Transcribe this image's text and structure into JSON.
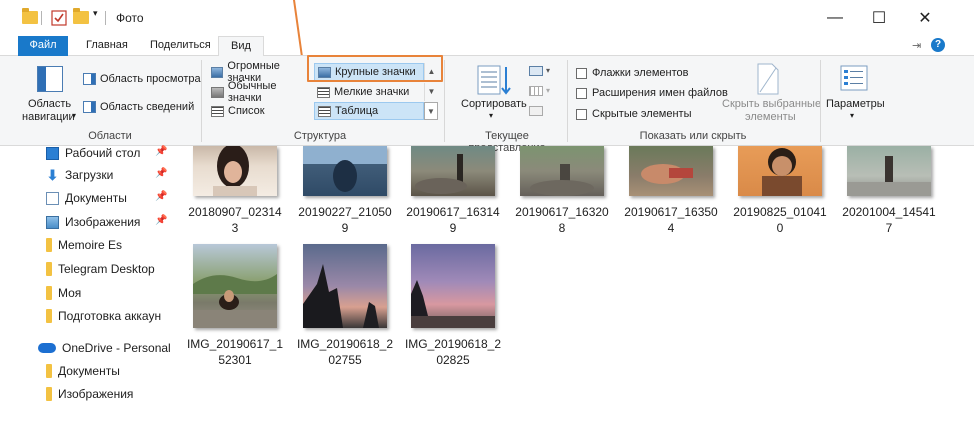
{
  "window": {
    "title": "Фото",
    "controls": {
      "minimize": "—",
      "maximize": "☐",
      "close": "✕"
    }
  },
  "tabs": [
    {
      "label": "Файл"
    },
    {
      "label": "Главная"
    },
    {
      "label": "Поделиться"
    },
    {
      "label": "Вид"
    }
  ],
  "ribbon": {
    "panes": {
      "nav_pane_line1": "Область",
      "nav_pane_line2": "навигации",
      "nav_pane_dropdown": "▾",
      "preview": "Область просмотра",
      "details": "Область сведений",
      "group_label": "Области"
    },
    "layout": {
      "items": [
        {
          "label": "Огромные значки"
        },
        {
          "label": "Крупные значки"
        },
        {
          "label": "Обычные значки"
        },
        {
          "label": "Мелкие значки"
        },
        {
          "label": "Список"
        },
        {
          "label": "Таблица"
        }
      ],
      "group_label": "Структура"
    },
    "current_view": {
      "sort": "Сортировать",
      "sort_dropdown": "▾",
      "group_label": "Текущее представление"
    },
    "show_hide": {
      "checkboxes": [
        {
          "label": "Флажки элементов",
          "checked": false
        },
        {
          "label": "Расширения имен файлов",
          "checked": false
        },
        {
          "label": "Скрытые элементы",
          "checked": false
        }
      ],
      "hide_selected_line1": "Скрыть выбранные",
      "hide_selected_line2": "элементы",
      "group_label": "Показать или скрыть"
    },
    "options": {
      "label": "Параметры",
      "dropdown": "▾"
    }
  },
  "navigation": {
    "quick_access": [
      {
        "label": "Рабочий стол",
        "icon": "desktop-icon",
        "pinned": true
      },
      {
        "label": "Загрузки",
        "icon": "download-icon",
        "pinned": true
      },
      {
        "label": "Документы",
        "icon": "documents-icon",
        "pinned": true
      },
      {
        "label": "Изображения",
        "icon": "pictures-icon",
        "pinned": true
      },
      {
        "label": "Memoire Es",
        "icon": "folder-icon",
        "pinned": false
      },
      {
        "label": "Telegram Desktop",
        "icon": "folder-icon",
        "pinned": false
      },
      {
        "label": "Моя",
        "icon": "folder-icon",
        "pinned": false
      },
      {
        "label": "Подготовка аккаун",
        "icon": "folder-icon",
        "pinned": false
      }
    ],
    "onedrive": {
      "label": "OneDrive - Personal",
      "icon": "cloud-icon"
    },
    "onedrive_items": [
      {
        "label": "Документы",
        "icon": "folder-icon"
      },
      {
        "label": "Изображения",
        "icon": "folder-icon"
      }
    ]
  },
  "files": [
    {
      "line1": "20180907_02314",
      "line2": "3"
    },
    {
      "line1": "20190227_21050",
      "line2": "9"
    },
    {
      "line1": "20190617_16314",
      "line2": "9"
    },
    {
      "line1": "20190617_16320",
      "line2": "8"
    },
    {
      "line1": "20190617_16350",
      "line2": "4"
    },
    {
      "line1": "20190825_01041",
      "line2": "0"
    },
    {
      "line1": "20201004_14541",
      "line2": "7"
    },
    {
      "line1": "IMG_20190617_1",
      "line2": "52301"
    },
    {
      "line1": "IMG_20190618_2",
      "line2": "02755"
    },
    {
      "line1": "IMG_20190618_2",
      "line2": "02825"
    }
  ],
  "accent": {
    "file_tab": "#1979ca",
    "highlight": "#e8833a",
    "selection": "#cce4f7"
  }
}
